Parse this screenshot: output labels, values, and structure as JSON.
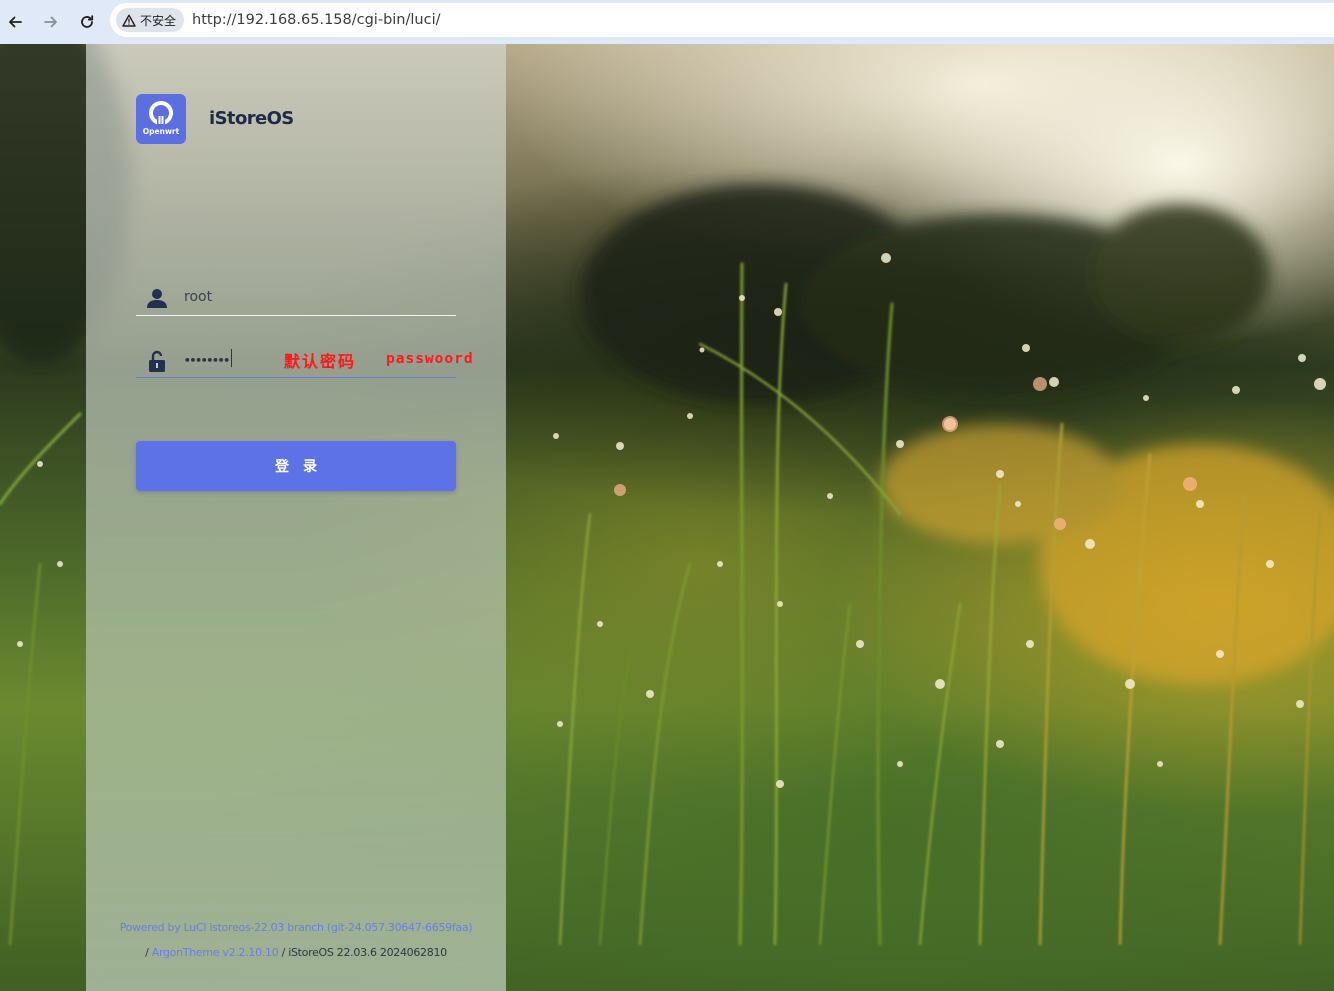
{
  "browser": {
    "back_icon": "arrow-left-icon",
    "forward_icon": "arrow-right-icon",
    "reload_icon": "reload-icon",
    "security_icon": "warning-triangle-icon",
    "security_label": "不安全",
    "url": "http://192.168.65.158/cgi-bin/luci/"
  },
  "login": {
    "logo_caption": "Openwrt",
    "brand": "iStoreOS",
    "username_value": "root",
    "password_masked": "••••••••",
    "annotation_cn": "默认密码",
    "annotation_en": "passwoord",
    "submit_label": "登录"
  },
  "footer": {
    "line1_link": "Powered by LuCI istoreos-22.03 branch (git-24.057.30647-6659faa)",
    "line2_prefix": "/ ",
    "line2_link": "ArgonTheme v2.2.10.10",
    "line2_suffix": " / iStoreOS 22.03.6 2024062810"
  },
  "colors": {
    "accent": "#5d72e6",
    "annotation": "#ff1818",
    "brand_text": "#1d2b47"
  }
}
